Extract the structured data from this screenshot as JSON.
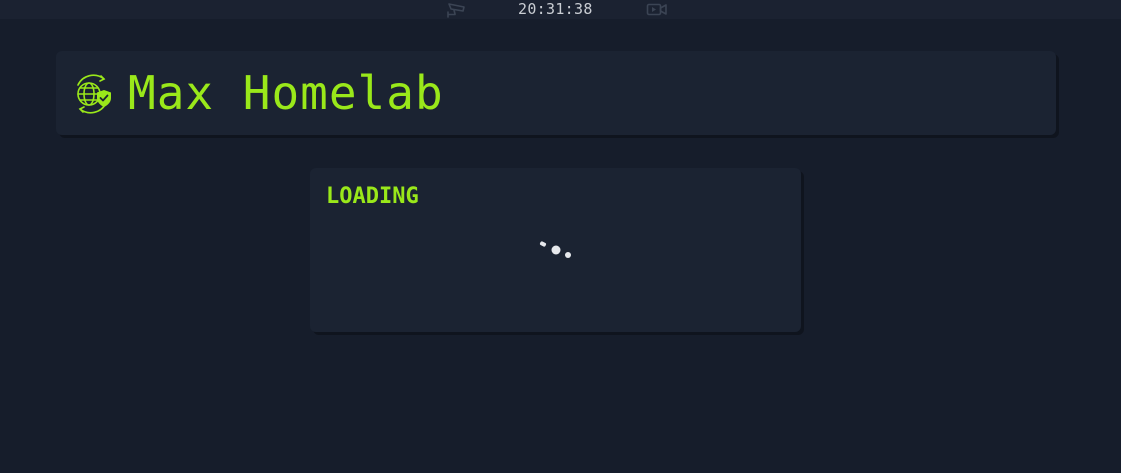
{
  "topbar": {
    "clock": "20:31:38",
    "left_icon": "security-camera-icon",
    "right_icon": "video-camera-icon"
  },
  "header": {
    "title": "Max Homelab",
    "logo_icon": "globe-shield-icon"
  },
  "loading": {
    "label": "LOADING",
    "spinner_icon": "loading-spinner-icon"
  },
  "colors": {
    "background": "#161d2b",
    "card": "#1b2332",
    "accent": "#9ae81a",
    "clock_text": "#c9cdd3"
  }
}
